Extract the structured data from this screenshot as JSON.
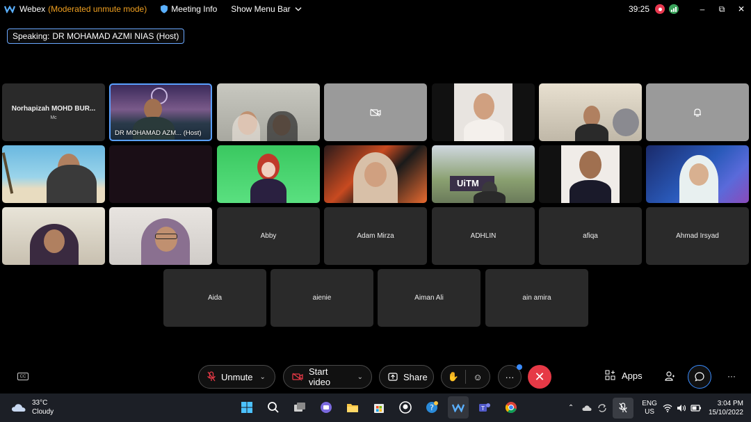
{
  "titlebar": {
    "app_name": "Webex",
    "mode": "(Moderated unmute mode)",
    "meeting_info": "Meeting Info",
    "show_menu_bar": "Show Menu Bar",
    "elapsed_time": "39:25"
  },
  "speaking": {
    "label": "Speaking:",
    "name": "DR MOHAMAD AZMI NIAS (Host)"
  },
  "participants": {
    "p1_name": "Norhapizah  MOHD BUR...",
    "p1_subtitle": "Mc",
    "host_caption": "DR MOHAMAD AZM... (Host)",
    "abby": "Abby",
    "adam": "Adam Mirza",
    "adhlin": "ADHLIN",
    "afiqa": "afiqa",
    "ahmad": "Ahmad Irsyad",
    "aida": "Aida",
    "aienie": "aienie",
    "aiman": "Aiman Ali",
    "ain": "ain amira",
    "campus_sign": "UiTM"
  },
  "controls": {
    "unmute": "Unmute",
    "start_video": "Start video",
    "share": "Share",
    "apps": "Apps"
  },
  "taskbar": {
    "temperature": "33°C",
    "weather": "Cloudy",
    "lang_top": "ENG",
    "lang_bottom": "US",
    "time": "3:04 PM",
    "date": "15/10/2022"
  },
  "colors": {
    "moderated_mode": "#f0a020",
    "active_border": "#5aa0ff",
    "end_call": "#e63946",
    "recording": "#e8384f"
  }
}
